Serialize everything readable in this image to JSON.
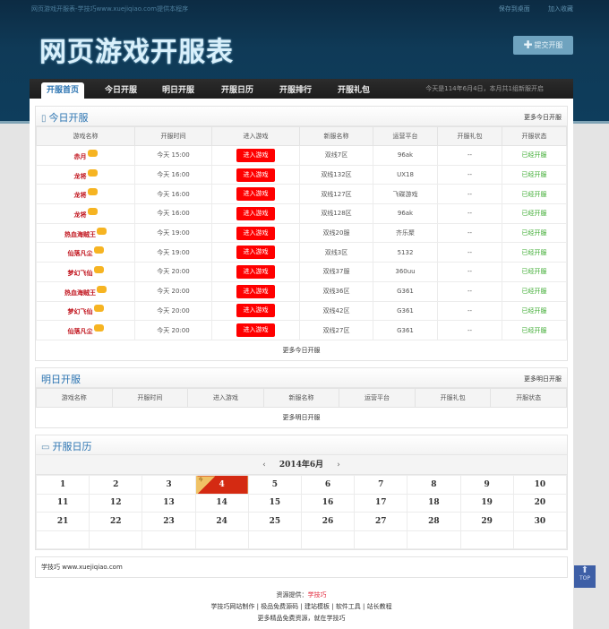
{
  "header": {
    "topline": "网页游戏开服表-学技巧www.xuejiqiao.com提供本程序",
    "links": [
      "保存到桌面",
      "加入收藏"
    ],
    "title": "网页游戏开服表",
    "submit_label": "提交开服",
    "submit_icon": "plus-icon"
  },
  "nav": {
    "tabs": [
      {
        "label": "开服首页",
        "active": true
      },
      {
        "label": "今日开服"
      },
      {
        "label": "明日开服"
      },
      {
        "label": "开服日历"
      },
      {
        "label": "开服排行"
      },
      {
        "label": "开服礼包"
      }
    ],
    "date_text": "今天是114年6月4日，本月共1组新服开启"
  },
  "today": {
    "title": "今日开服",
    "icon": "book-icon",
    "more_label": "更多今日开服",
    "columns": [
      "游戏名称",
      "开服时间",
      "进入游戏",
      "新服名称",
      "运营平台",
      "开服礼包",
      "开服状态"
    ],
    "rows": [
      {
        "name": "赤月",
        "time": "今天 15:00",
        "enter": "进入游戏",
        "server": "双线7区",
        "platform": "96ak",
        "gift": "--",
        "status": "已经开服"
      },
      {
        "name": "龙将",
        "time": "今天 16:00",
        "enter": "进入游戏",
        "server": "双线132区",
        "platform": "UX18",
        "gift": "--",
        "status": "已经开服"
      },
      {
        "name": "龙将",
        "time": "今天 16:00",
        "enter": "进入游戏",
        "server": "双线127区",
        "platform": "飞碟游戏",
        "gift": "--",
        "status": "已经开服"
      },
      {
        "name": "龙将",
        "time": "今天 16:00",
        "enter": "进入游戏",
        "server": "双线128区",
        "platform": "96ak",
        "gift": "--",
        "status": "已经开服"
      },
      {
        "name": "热血海贼王",
        "time": "今天 19:00",
        "enter": "进入游戏",
        "server": "双线20服",
        "platform": "齐乐聚",
        "gift": "--",
        "status": "已经开服"
      },
      {
        "name": "仙落凡尘",
        "time": "今天 19:00",
        "enter": "进入游戏",
        "server": "双线3区",
        "platform": "5132",
        "gift": "--",
        "status": "已经开服"
      },
      {
        "name": "梦幻飞仙",
        "time": "今天 20:00",
        "enter": "进入游戏",
        "server": "双线37服",
        "platform": "360uu",
        "gift": "--",
        "status": "已经开服"
      },
      {
        "name": "热血海贼王",
        "time": "今天 20:00",
        "enter": "进入游戏",
        "server": "双线36区",
        "platform": "G361",
        "gift": "--",
        "status": "已经开服"
      },
      {
        "name": "梦幻飞仙",
        "time": "今天 20:00",
        "enter": "进入游戏",
        "server": "双线42区",
        "platform": "G361",
        "gift": "--",
        "status": "已经开服"
      },
      {
        "name": "仙落凡尘",
        "time": "今天 20:00",
        "enter": "进入游戏",
        "server": "双线27区",
        "platform": "G361",
        "gift": "--",
        "status": "已经开服"
      }
    ],
    "footer_more": "更多今日开服"
  },
  "tomorrow": {
    "title": "明日开服",
    "more_label": "更多明日开服",
    "columns": [
      "游戏名称",
      "开服时间",
      "进入游戏",
      "新服名称",
      "运营平台",
      "开服礼包",
      "开服状态"
    ],
    "footer_more": "更多明日开服"
  },
  "calendar": {
    "title": "开服日历",
    "icon": "calendar-icon",
    "month_label": "2014年6月",
    "prev": "‹",
    "next": "›",
    "today": 4,
    "today_tag": "今",
    "weeks": [
      [
        "1",
        "2",
        "3",
        "4",
        "5",
        "6",
        "7",
        "8",
        "9",
        "10"
      ],
      [
        "11",
        "12",
        "13",
        "14",
        "15",
        "16",
        "17",
        "18",
        "19",
        "20"
      ],
      [
        "21",
        "22",
        "23",
        "24",
        "25",
        "26",
        "27",
        "28",
        "29",
        "30"
      ],
      [
        "",
        "",
        "",
        "",
        "",
        "",
        "",
        "",
        "",
        ""
      ]
    ]
  },
  "footer": {
    "site": "学技巧 www.xuejiqiao.com",
    "source_label": "资源提供：",
    "source_name": "学技巧",
    "links": [
      "学技巧网站制作",
      "极品免费源码",
      "建站模板",
      "软件工具",
      "站长教程"
    ],
    "tagline": "更多精品免费资源，就在学技巧",
    "top_label": "TOP"
  }
}
